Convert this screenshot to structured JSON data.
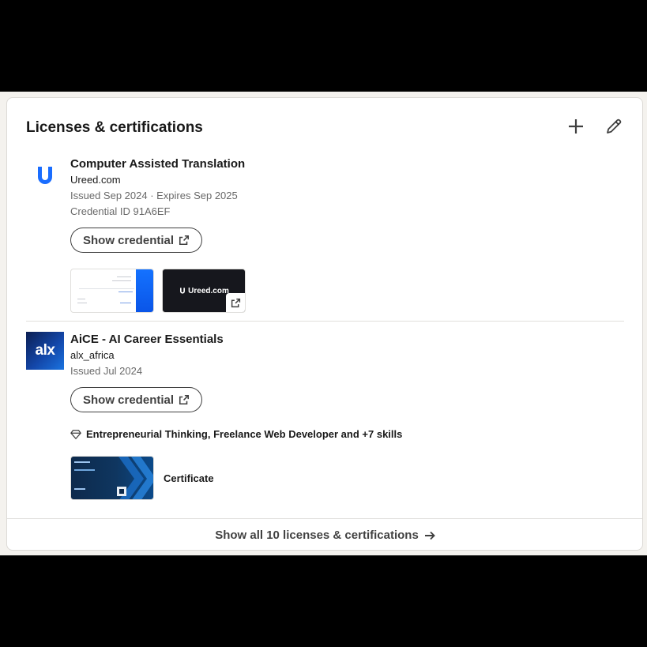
{
  "section": {
    "title": "Licenses & certifications",
    "add_icon": "plus-icon",
    "edit_icon": "pencil-icon"
  },
  "entries": [
    {
      "title": "Computer Assisted Translation",
      "org": "Ureed.com",
      "issued": "Issued Sep 2024 · Expires Sep 2025",
      "credential_id": "Credential ID 91A6EF",
      "button_label": "Show credential",
      "logo_icon": "ureed-logo-icon",
      "media_brand": "Ureed.com"
    },
    {
      "title": "AiCE - AI Career Essentials",
      "org": "alx_africa",
      "issued": "Issued Jul 2024",
      "button_label": "Show credential",
      "logo_text": "alx",
      "skills": "Entrepreneurial Thinking, Freelance Web Developer and +7 skills",
      "media_label": "Certificate"
    }
  ],
  "footer": {
    "label": "Show all 10 licenses & certifications"
  },
  "colors": {
    "ureed_blue": "#1a6dff",
    "alx_dark": "#0b1e52",
    "page_bg": "#f4f2ee"
  }
}
